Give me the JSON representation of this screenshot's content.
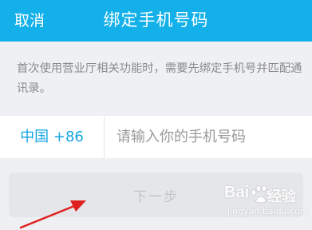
{
  "header": {
    "cancel_label": "取消",
    "title": "绑定手机号码"
  },
  "description": "首次使用营业厅相关功能时，需要先绑定手机号并匹配通讯录。",
  "phone": {
    "country_code": "中国 +86",
    "placeholder": "请输入你的手机号码",
    "value": ""
  },
  "next_button_label": "下一步",
  "watermark": {
    "brand_left": "Bai",
    "brand_right": "经验",
    "url": "jingyan.baidu.com"
  },
  "colors": {
    "header_bg": "#13b0ea",
    "accent": "#13a5e0",
    "page_bg": "#eef0f3",
    "button_bg": "#e4e6e9",
    "arrow": "#e02020"
  },
  "icons": {
    "arrow": "red-pointer-arrow",
    "paw": "baidu-paw-logo"
  }
}
